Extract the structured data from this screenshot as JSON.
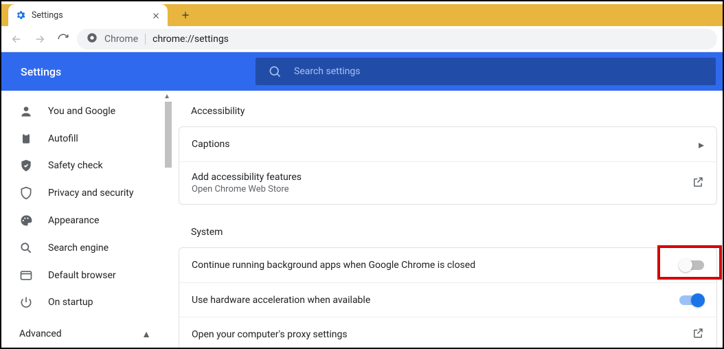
{
  "tab": {
    "title": "Settings"
  },
  "omnibox": {
    "scheme_label": "Chrome",
    "url": "chrome://settings"
  },
  "header": {
    "title": "Settings"
  },
  "search": {
    "placeholder": "Search settings"
  },
  "sidebar": {
    "items": [
      {
        "label": "You and Google"
      },
      {
        "label": "Autofill"
      },
      {
        "label": "Safety check"
      },
      {
        "label": "Privacy and security"
      },
      {
        "label": "Appearance"
      },
      {
        "label": "Search engine"
      },
      {
        "label": "Default browser"
      },
      {
        "label": "On startup"
      }
    ],
    "advanced_label": "Advanced"
  },
  "sections": {
    "accessibility": {
      "title": "Accessibility",
      "rows": [
        {
          "title": "Captions"
        },
        {
          "title": "Add accessibility features",
          "sub": "Open Chrome Web Store"
        }
      ]
    },
    "system": {
      "title": "System",
      "rows": [
        {
          "title": "Continue running background apps when Google Chrome is closed",
          "toggle": "off",
          "highlighted": true
        },
        {
          "title": "Use hardware acceleration when available",
          "toggle": "on"
        },
        {
          "title": "Open your computer's proxy settings"
        }
      ]
    }
  }
}
